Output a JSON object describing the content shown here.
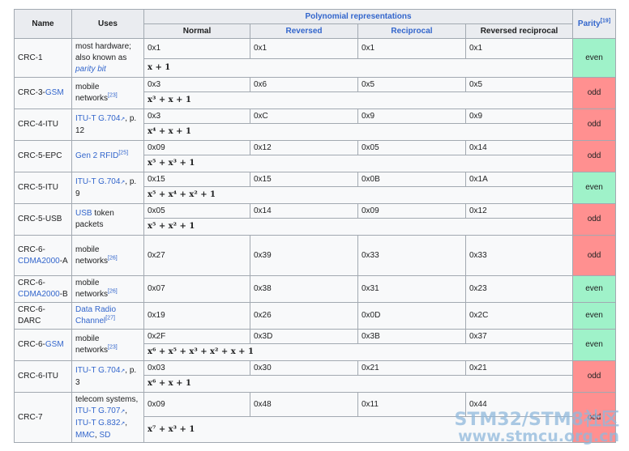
{
  "header": {
    "name": "Name",
    "uses": "Uses",
    "poly_group": "Polynomial representations",
    "parity": "Parity",
    "parity_ref": "[19]",
    "normal": "Normal",
    "reversed": "Reversed",
    "reciprocal": "Reciprocal",
    "reversed_reciprocal": "Reversed reciprocal"
  },
  "rows": {
    "crc1": {
      "name": "CRC-1",
      "uses1": "most hardware; also known as ",
      "uses_link": "parity bit",
      "normal": "0x1",
      "reversed": "0x1",
      "reciprocal": "0x1",
      "rev_recip": "0x1",
      "poly": "x + 1",
      "parity": "even"
    },
    "crc3gsm": {
      "name_prefix": "CRC-3-",
      "name_link": "GSM",
      "uses": "mobile networks",
      "uses_ref": "[23]",
      "normal": "0x3",
      "reversed": "0x6",
      "reciprocal": "0x5",
      "rev_recip": "0x5",
      "poly": "x³ + x + 1",
      "parity": "odd"
    },
    "crc4itu": {
      "name": "CRC-4-ITU",
      "uses_link": "ITU-T G.704",
      "uses_after": ", p. 12",
      "normal": "0x3",
      "reversed": "0xC",
      "reciprocal": "0x9",
      "rev_recip": "0x9",
      "poly": "x⁴ + x + 1",
      "parity": "odd"
    },
    "crc5epc": {
      "name": "CRC-5-EPC",
      "uses_link": "Gen 2 RFID",
      "uses_ref": "[25]",
      "normal": "0x09",
      "reversed": "0x12",
      "reciprocal": "0x05",
      "rev_recip": "0x14",
      "poly": "x⁵ + x³ + 1",
      "parity": "odd"
    },
    "crc5itu": {
      "name": "CRC-5-ITU",
      "uses_link": "ITU-T G.704",
      "uses_after": ", p. 9",
      "normal": "0x15",
      "reversed": "0x15",
      "reciprocal": "0x0B",
      "rev_recip": "0x1A",
      "poly": "x⁵ + x⁴ + x² + 1",
      "parity": "even"
    },
    "crc5usb": {
      "name": "CRC-5-USB",
      "uses_link": "USB",
      "uses_after": " token packets",
      "normal": "0x05",
      "reversed": "0x14",
      "reciprocal": "0x09",
      "rev_recip": "0x12",
      "poly": "x⁵ + x² + 1",
      "parity": "odd"
    },
    "crc6cdmaA": {
      "name_prefix": "CRC-6-",
      "name_link": "CDMA2000",
      "name_suffix": "-A",
      "uses": "mobile networks",
      "uses_ref": "[26]",
      "normal": "0x27",
      "reversed": "0x39",
      "reciprocal": "0x33",
      "rev_recip": "0x33",
      "parity": "odd"
    },
    "crc6cdmaB": {
      "name_prefix": "CRC-6-",
      "name_link": "CDMA2000",
      "name_suffix": "-B",
      "uses": "mobile networks",
      "uses_ref": "[26]",
      "normal": "0x07",
      "reversed": "0x38",
      "reciprocal": "0x31",
      "rev_recip": "0x23",
      "parity": "even"
    },
    "crc6darc": {
      "name": "CRC-6-DARC",
      "uses_link": "Data Radio Channel",
      "uses_ref": "[27]",
      "normal": "0x19",
      "reversed": "0x26",
      "reciprocal": "0x0D",
      "rev_recip": "0x2C",
      "parity": "even"
    },
    "crc6gsm": {
      "name_prefix": "CRC-6-",
      "name_link": "GSM",
      "uses": "mobile networks",
      "uses_ref": "[23]",
      "normal": "0x2F",
      "reversed": "0x3D",
      "reciprocal": "0x3B",
      "rev_recip": "0x37",
      "poly": "x⁶ + x⁵ + x³ + x² + x + 1",
      "parity": "even"
    },
    "crc6itu": {
      "name": "CRC-6-ITU",
      "uses_link": "ITU-T G.704",
      "uses_after": ", p. 3",
      "normal": "0x03",
      "reversed": "0x30",
      "reciprocal": "0x21",
      "rev_recip": "0x21",
      "poly": "x⁶ + x + 1",
      "parity": "odd"
    },
    "crc7": {
      "name": "CRC-7",
      "uses1": "telecom systems, ",
      "uses_link1": "ITU-T G.707",
      "uses_link2": "ITU-T G.832",
      "uses_link3": "MMC",
      "uses_sep": ", ",
      "uses_link4": "SD",
      "normal": "0x09",
      "reversed": "0x48",
      "reciprocal": "0x11",
      "rev_recip": "0x44",
      "poly": "x⁷ + x³ + 1",
      "parity": "odd"
    }
  },
  "watermark": {
    "line1": "STM32/STM8社区",
    "line2": "www.stmcu.org.cn"
  }
}
